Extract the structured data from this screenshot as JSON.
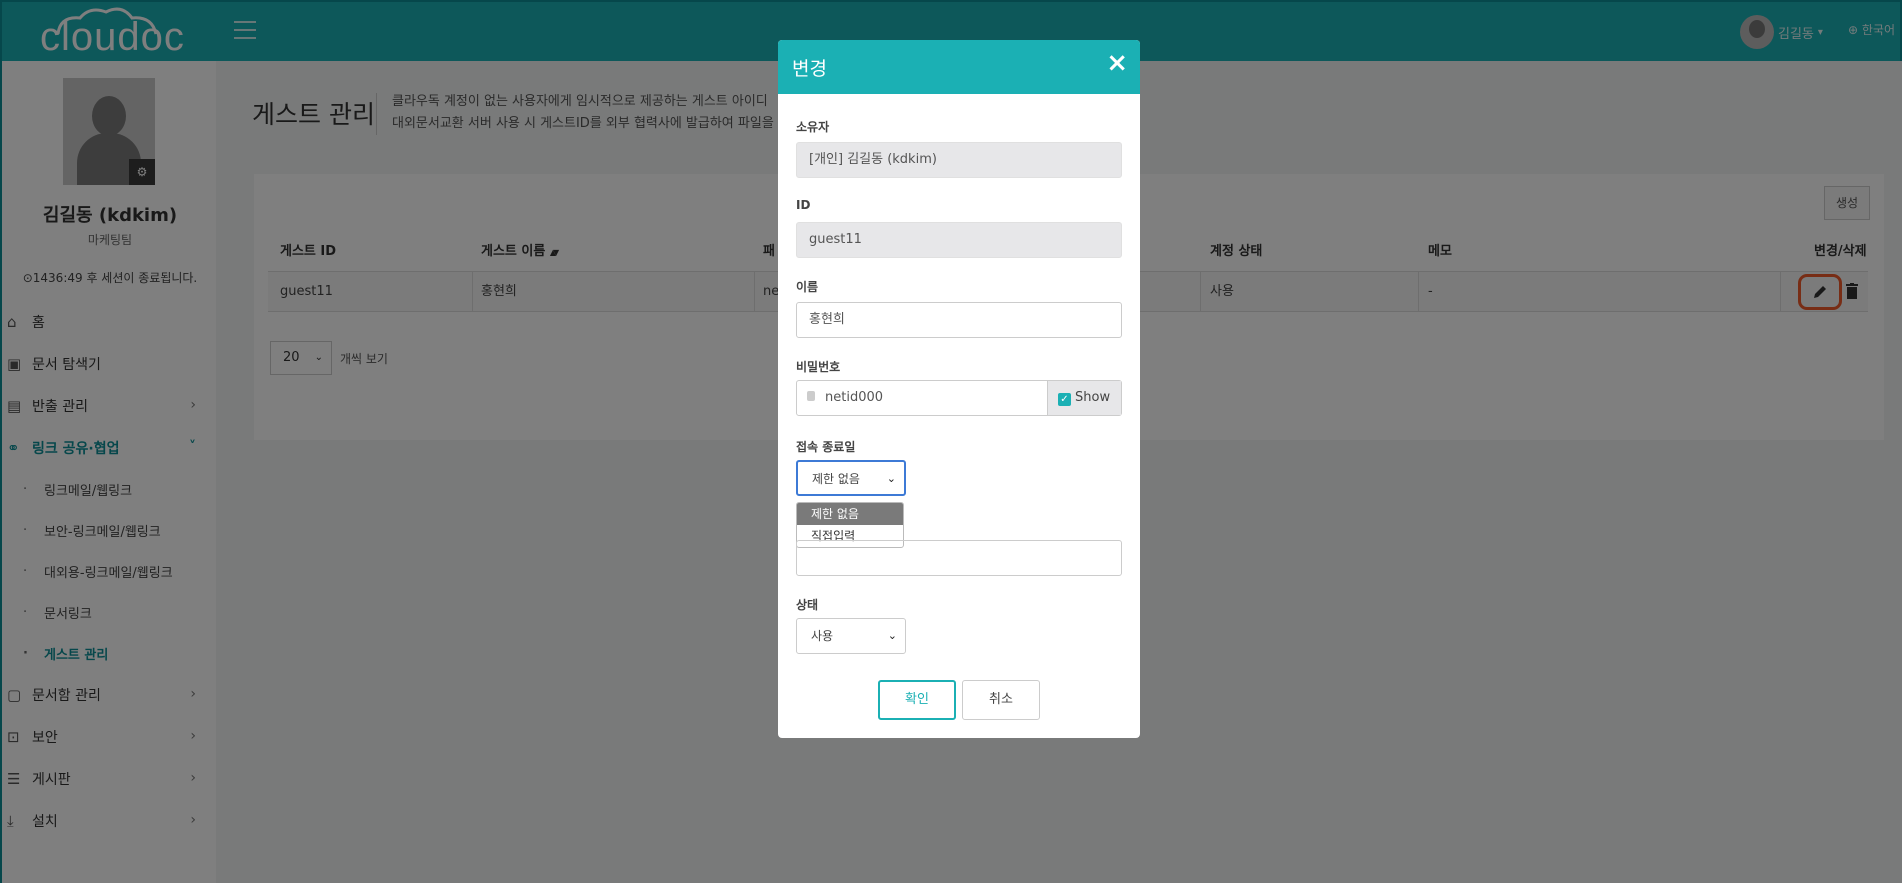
{
  "header": {
    "logo": "cloudoc",
    "user_name": "김길동",
    "user_caret": "▾",
    "language": "한국어"
  },
  "sidebar": {
    "profile_name": "김길동 (kdkim)",
    "team": "마케팅팀",
    "session": "1436:49 후 세션이 종료됩니다.",
    "menu": [
      {
        "label": "홈",
        "icon": "home-icon"
      },
      {
        "label": "문서 탐색기",
        "icon": "folder-search-icon"
      },
      {
        "label": "반출 관리",
        "icon": "export-doc-icon"
      },
      {
        "label": "링크 공유·협업",
        "icon": "link-share-icon"
      },
      {
        "label": "문서함 관리",
        "icon": "folder-gear-icon"
      },
      {
        "label": "보안",
        "icon": "lock-icon"
      },
      {
        "label": "게시판",
        "icon": "board-icon"
      },
      {
        "label": "설치",
        "icon": "download-icon"
      }
    ],
    "submenu": [
      "링크메일/웹링크",
      "보안-링크메일/웹링크",
      "대외용-링크메일/웹링크",
      "문서링크",
      "게스트 관리"
    ]
  },
  "main": {
    "title": "게스트 관리",
    "desc_line1": "클라우독 계정이 없는 사용자에게 임시적으로 제공하는 게스트 아이디",
    "desc_line2": "대외문서교환 서버 사용 시 게스트ID를 외부 협력사에 발급하여 파일을",
    "create_label": "생성",
    "columns": {
      "guest_id": "게스트 ID",
      "guest_name": "게스트 이름",
      "col3": "패",
      "status": "계정 상태",
      "memo": "메모",
      "actions": "변경/삭제"
    },
    "sort_icon": "▲▼",
    "row": {
      "guest_id": "guest11",
      "guest_name": "홍현희",
      "col3": "ne",
      "status": "사용",
      "memo": "-"
    },
    "page_size": "20",
    "page_size_label": "개씩 보기"
  },
  "modal": {
    "title": "변경",
    "close": "×",
    "owner_label": "소유자",
    "owner_value": "[개인] 김길동 (kdkim)",
    "id_label": "ID",
    "id_value": "guest11",
    "name_label": "이름",
    "name_value": "홍현희",
    "password_label": "비밀번호",
    "password_value": "netid000",
    "show_label": "Show",
    "expire_label": "접속 종료일",
    "expire_value": "제한 없음",
    "expire_options": [
      "제한 없음",
      "직접입력"
    ],
    "status_label": "상태",
    "status_value": "사용",
    "confirm_label": "확인",
    "cancel_label": "취소"
  },
  "colors": {
    "brand": "#1bb0b4",
    "brand_dark": "#0d8f96",
    "highlight": "#f05a2a"
  }
}
